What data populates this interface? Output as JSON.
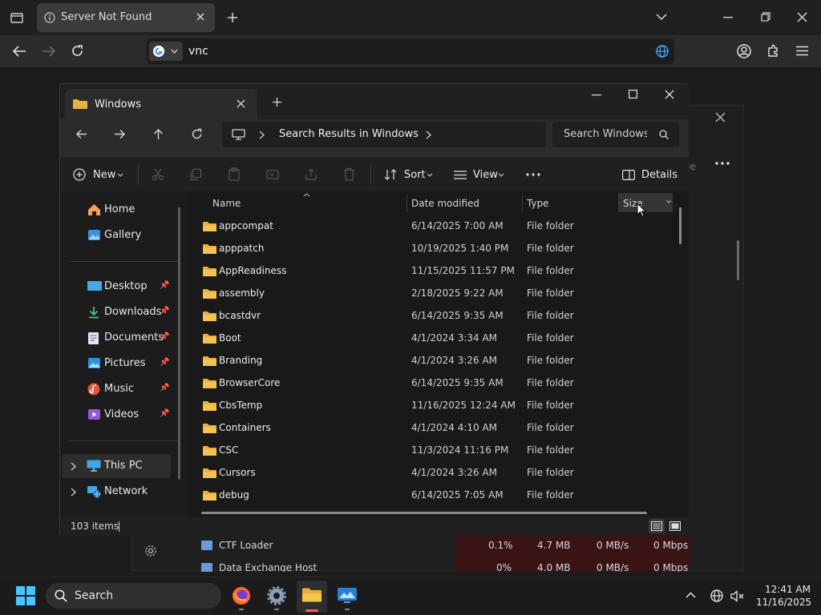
{
  "browser": {
    "tab_title": "Server Not Found",
    "address": "vnc"
  },
  "explorer": {
    "tab_title": "Windows",
    "breadcrumb": "Search Results in Windows",
    "search_placeholder": "Search Windows",
    "cmd": {
      "new": "New",
      "sort": "Sort",
      "view": "View",
      "details": "Details"
    },
    "nav": [
      {
        "label": "Home",
        "icon": "home-icon"
      },
      {
        "label": "Gallery",
        "icon": "gallery-icon"
      },
      {
        "label": "Desktop",
        "icon": "desktop-icon"
      },
      {
        "label": "Downloads",
        "icon": "download-icon"
      },
      {
        "label": "Documents",
        "icon": "documents-icon"
      },
      {
        "label": "Pictures",
        "icon": "pictures-icon"
      },
      {
        "label": "Music",
        "icon": "music-icon"
      },
      {
        "label": "Videos",
        "icon": "videos-icon"
      },
      {
        "label": "This PC",
        "icon": "pc-icon"
      },
      {
        "label": "Network",
        "icon": "network-icon"
      }
    ],
    "columns": {
      "name": "Name",
      "date": "Date modified",
      "type": "Type",
      "size": "Size"
    },
    "files": [
      {
        "name": "appcompat",
        "date": "6/14/2025 7:00 AM",
        "type": "File folder"
      },
      {
        "name": "apppatch",
        "date": "10/19/2025 1:40 PM",
        "type": "File folder"
      },
      {
        "name": "AppReadiness",
        "date": "11/15/2025 11:57 PM",
        "type": "File folder"
      },
      {
        "name": "assembly",
        "date": "2/18/2025 9:22 AM",
        "type": "File folder"
      },
      {
        "name": "bcastdvr",
        "date": "6/14/2025 9:35 AM",
        "type": "File folder"
      },
      {
        "name": "Boot",
        "date": "4/1/2024 3:34 AM",
        "type": "File folder"
      },
      {
        "name": "Branding",
        "date": "4/1/2024 3:26 AM",
        "type": "File folder"
      },
      {
        "name": "BrowserCore",
        "date": "6/14/2025 9:35 AM",
        "type": "File folder"
      },
      {
        "name": "CbsTemp",
        "date": "11/16/2025 12:24 AM",
        "type": "File folder"
      },
      {
        "name": "Containers",
        "date": "4/1/2024 4:10 AM",
        "type": "File folder"
      },
      {
        "name": "CSC",
        "date": "11/3/2024 11:16 PM",
        "type": "File folder"
      },
      {
        "name": "Cursors",
        "date": "4/1/2024 3:26 AM",
        "type": "File folder"
      },
      {
        "name": "debug",
        "date": "6/14/2025 7:05 AM",
        "type": "File folder"
      }
    ],
    "status": "103 items"
  },
  "taskmgr": {
    "rows": [
      {
        "name": "CTF Loader",
        "cpu": "0.1%",
        "mem": "4.7 MB",
        "disk": "0 MB/s",
        "net": "0 Mbps"
      },
      {
        "name": "Data Exchange Host",
        "cpu": "0%",
        "mem": "4.0 MB",
        "disk": "0 MB/s",
        "net": "0 Mbps"
      }
    ],
    "fragment": "le"
  },
  "taskbar": {
    "search": "Search",
    "time": "12:41 AM",
    "date": "11/16/2025"
  },
  "colors": {
    "folder": "#e8b23a",
    "accent": "#4aa8ff"
  }
}
